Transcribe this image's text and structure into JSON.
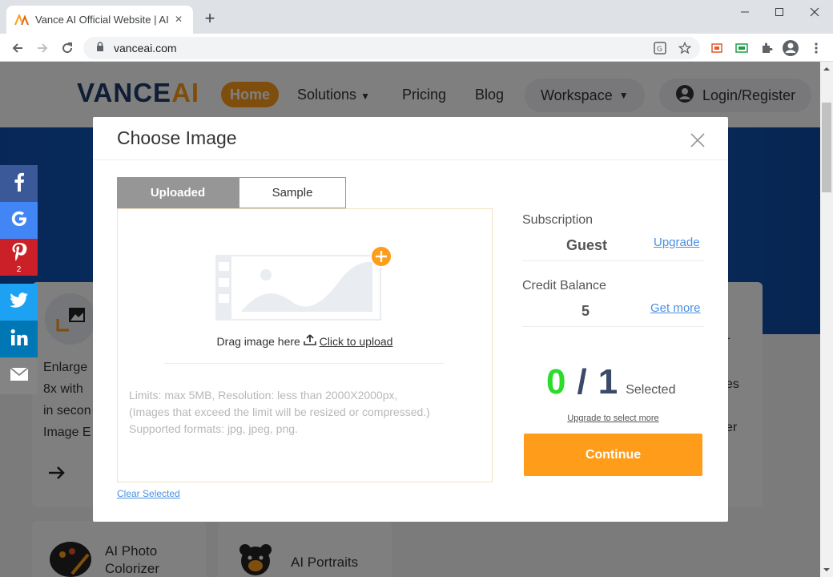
{
  "browser": {
    "tab_title": "Vance AI Official Website | AI Im",
    "url": "vanceai.com"
  },
  "site": {
    "logo_main": "VANCE",
    "logo_ai": "AI",
    "nav": {
      "home": "Home",
      "solutions": "Solutions",
      "pricing": "Pricing",
      "blog": "Blog",
      "workspace": "Workspace",
      "login": "Login/Register"
    },
    "cards": {
      "enlarger_lines": [
        "Enlarge",
        "8x with",
        "in secon",
        "Image E"
      ],
      "right_lines": [
        "r",
        "es",
        "er"
      ],
      "colorizer_line1": "AI Photo",
      "colorizer_line2": "Colorizer",
      "portraits": "AI Portraits"
    }
  },
  "share": {
    "pinterest_count": "2",
    "colors": {
      "facebook": "#3b5998",
      "google": "#dd4b39",
      "pinterest": "#cb2027",
      "twitter": "#1da1f2",
      "linkedin": "#0077b5",
      "email": "#848484"
    }
  },
  "modal": {
    "title": "Choose Image",
    "tabs": {
      "uploaded": "Uploaded",
      "sample": "Sample"
    },
    "drop_text": "Drag image here",
    "upload_link": "Click to upload",
    "limits": [
      "Limits: max 5MB,  Resolution: less than 2000X2000px,",
      "(Images that exceed the limit will be resized or compressed.)",
      "Supported formats: jpg, jpeg, png."
    ],
    "clear_selected": "Clear Selected",
    "subscription_label": "Subscription",
    "subscription_value": "Guest",
    "upgrade_link": "Upgrade",
    "credit_label": "Credit Balance",
    "credit_value": "5",
    "get_more_link": "Get more",
    "selected_count": "0",
    "separator": "/",
    "max_count": "1",
    "selected_label": "Selected",
    "upgrade_more_link": "Upgrade to select more",
    "continue_label": "Continue"
  }
}
